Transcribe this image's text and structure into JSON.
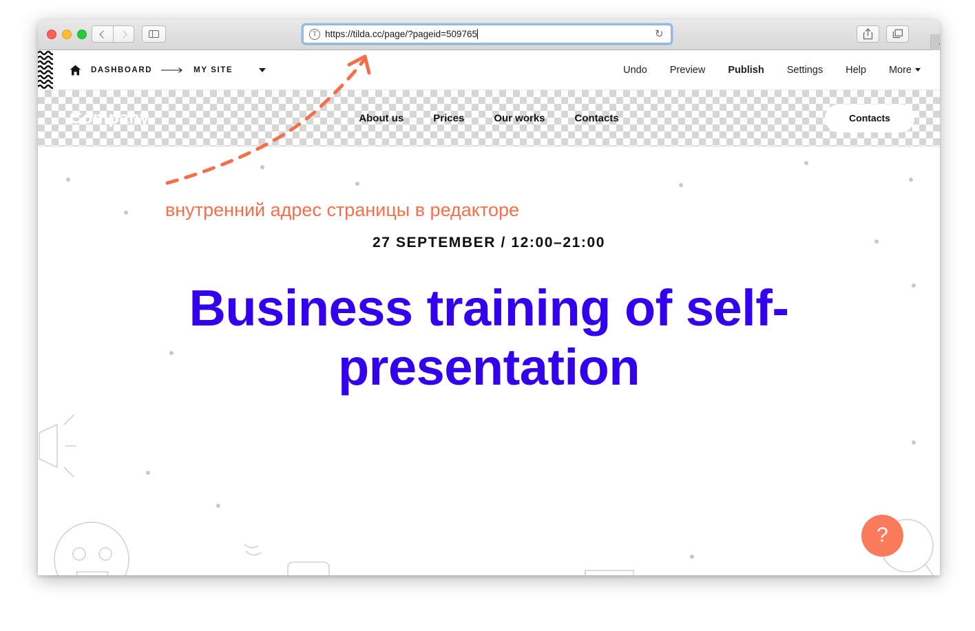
{
  "browser": {
    "url": "https://tilda.cc/page/?pageid=509765",
    "favicon_letter": "T",
    "controls": {
      "close": "close-window",
      "minimize": "minimize-window",
      "maximize": "maximize-window",
      "back": "back",
      "forward": "forward",
      "sidebar": "show-sidebar",
      "share": "share",
      "tabs_overview": "tabs-overview",
      "new_tab": "+",
      "reload": "↻"
    }
  },
  "editor_topbar": {
    "home_icon": "home-icon",
    "breadcrumb": {
      "dashboard": "DASHBOARD",
      "separator": "⟶",
      "site": "MY SITE"
    },
    "actions": [
      {
        "label": "Undo",
        "bold": false
      },
      {
        "label": "Preview",
        "bold": false
      },
      {
        "label": "Publish",
        "bold": true
      },
      {
        "label": "Settings",
        "bold": false
      },
      {
        "label": "Help",
        "bold": false
      },
      {
        "label": "More",
        "bold": false,
        "caret": true
      }
    ]
  },
  "site": {
    "logo": "Company",
    "nav": [
      {
        "label": "About us"
      },
      {
        "label": "Prices"
      },
      {
        "label": "Our works"
      },
      {
        "label": "Contacts"
      }
    ],
    "cta_button": "Contacts",
    "hero": {
      "date": "27 SEPTEMBER / 12:00–21:00",
      "title": "Business training of self-presentation"
    },
    "help_button": "?"
  },
  "annotation": {
    "text": "внутренний адрес страницы в редакторе",
    "arrow": "curved-dashed-arrow-up-right"
  },
  "colors": {
    "annotation": "#f4704d",
    "hero_title": "#3300ee",
    "help_bubble": "#f97b5a",
    "checkerboard": "#d6d6d6"
  }
}
